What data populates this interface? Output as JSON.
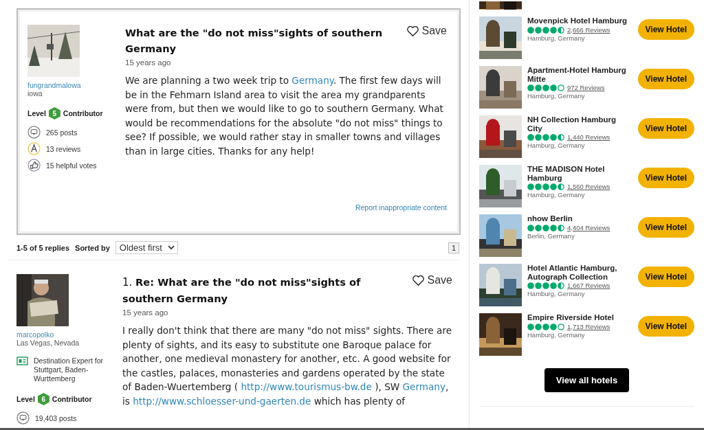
{
  "question": {
    "author": {
      "name": "fungrandmalowa",
      "location": "iowa",
      "level_label": "Level",
      "level": "5",
      "level_suffix": "Contributor",
      "stats": [
        {
          "kind": "posts",
          "text": "265 posts"
        },
        {
          "kind": "reviews",
          "text": "13 reviews"
        },
        {
          "kind": "votes",
          "text": "15 helpful votes"
        }
      ]
    },
    "title": "What are the \"do not miss\"sights of southern Germany",
    "save": "Save",
    "time": "15 years ago",
    "body": [
      {
        "text": "We are planning a two week trip to ",
        "link": false
      },
      {
        "text": "Germany",
        "link": true
      },
      {
        "text": ". The first few days will be in the Fehmarn Island area to visit the area my grandparents were from, but then we would like to go to southern Germany. What would be recommendations for the absolute \"do not miss\" things to see? If possible, we would rather stay in smaller towns and villages than in large cities. Thanks for any help!",
        "link": false
      }
    ],
    "report": "Report inappropriate content"
  },
  "replies_bar": {
    "count": "1-5 of 5 replies",
    "sorted_label": "Sorted by",
    "sort": "Oldest first",
    "page": "1"
  },
  "reply": {
    "number": "1.",
    "author": {
      "name": "marcopolko",
      "location": "Las Vegas, Nevada",
      "expert": "Destination Expert for Stuttgart, Baden-Wurttemberg",
      "level_label": "Level",
      "level": "6",
      "level_suffix": "Contributor",
      "stats": [
        {
          "kind": "posts",
          "text": "19,403 posts"
        }
      ]
    },
    "title": "Re: What are the \"do not miss\"sights of southern Germany",
    "save": "Save",
    "time": "15 years ago",
    "body": [
      {
        "text": "I really don't think that there are many \"do not miss\" sights. There are plenty of sights, and its easy to substitute one Baroque palace for another, one medieval monastery for another, etc. A good website for the castles, palaces, monasteries and gardens operated by the state of Baden-Wuertemberg ( ",
        "link": false
      },
      {
        "text": "http://www.tourismus-bw.de",
        "link": true
      },
      {
        "text": " ), SW ",
        "link": false
      },
      {
        "text": "Germany",
        "link": true
      },
      {
        "text": ", is ",
        "link": false
      },
      {
        "text": "http://www.schloesser-und-gaerten.de",
        "link": true
      },
      {
        "text": " which has plenty of",
        "link": false
      }
    ]
  },
  "hotels": [
    {
      "name": "Movenpick Hotel Hamburg",
      "stars": 4.5,
      "reviews": "2,666 Reviews",
      "location": "Hamburg, Germany",
      "button": "View Hotel"
    },
    {
      "name": "Apartment-Hotel Hamburg Mitte",
      "stars": 4,
      "reviews": "972 Reviews",
      "location": "Hamburg, Germany",
      "button": "View Hotel"
    },
    {
      "name": "NH Collection Hamburg City",
      "stars": 4.5,
      "reviews": "1,440 Reviews",
      "location": "Hamburg, Germany",
      "button": "View Hotel"
    },
    {
      "name": "THE MADISON Hotel Hamburg",
      "stars": 4.5,
      "reviews": "1,560 Reviews",
      "location": "Hamburg, Germany",
      "button": "View Hotel"
    },
    {
      "name": "nhow Berlin",
      "stars": 4.5,
      "reviews": "4,404 Reviews",
      "location": "Berlin, Germany",
      "button": "View Hotel"
    },
    {
      "name": "Hotel Atlantic Hamburg, Autograph Collection",
      "stars": 4.5,
      "reviews": "1,667 Reviews",
      "location": "Hamburg, Germany",
      "button": "View Hotel"
    },
    {
      "name": "Empire Riverside Hotel",
      "stars": 4,
      "reviews": "1,713 Reviews",
      "location": "Hamburg, Germany",
      "button": "View Hotel"
    }
  ],
  "view_all": "View all hotels"
}
